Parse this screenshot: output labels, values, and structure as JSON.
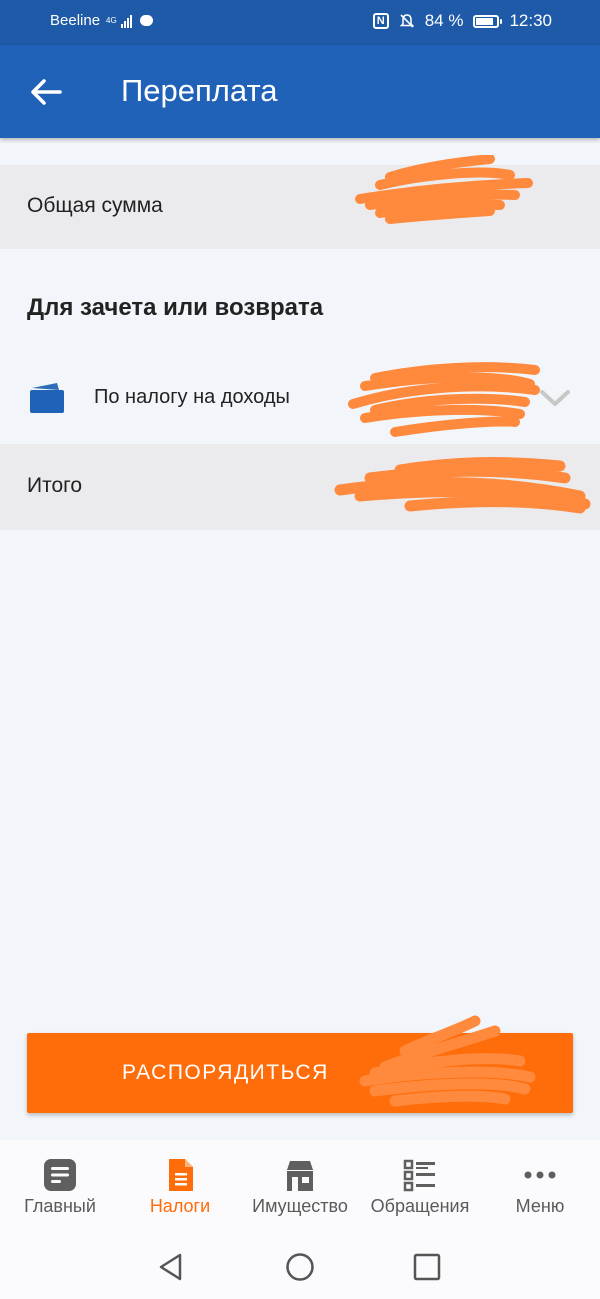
{
  "status_bar": {
    "carrier": "Beeline",
    "network": "4G",
    "battery": "84 %",
    "battery_level": 0.84,
    "time": "12:30"
  },
  "app_bar": {
    "title": "Переплата"
  },
  "summary": {
    "total_label": "Общая сумма",
    "section_title": "Для зачета или возврата",
    "income_tax_label": "По налогу на доходы",
    "itogo_label": "Итого"
  },
  "action_button": {
    "label": "РАСПОРЯДИТЬСЯ"
  },
  "bottom_nav": {
    "items": [
      {
        "label": "Главный",
        "icon": "document-icon"
      },
      {
        "label": "Налоги",
        "icon": "tax-document-icon",
        "active": true
      },
      {
        "label": "Имущество",
        "icon": "house-icon"
      },
      {
        "label": "Обращения",
        "icon": "list-icon"
      },
      {
        "label": "Меню",
        "icon": "more-dots-icon"
      }
    ]
  },
  "colors": {
    "primary_blue": "#1f62b7",
    "status_blue": "#1e5aa8",
    "accent_orange": "#ff6d0a",
    "redaction_orange": "#ff8a3d"
  }
}
